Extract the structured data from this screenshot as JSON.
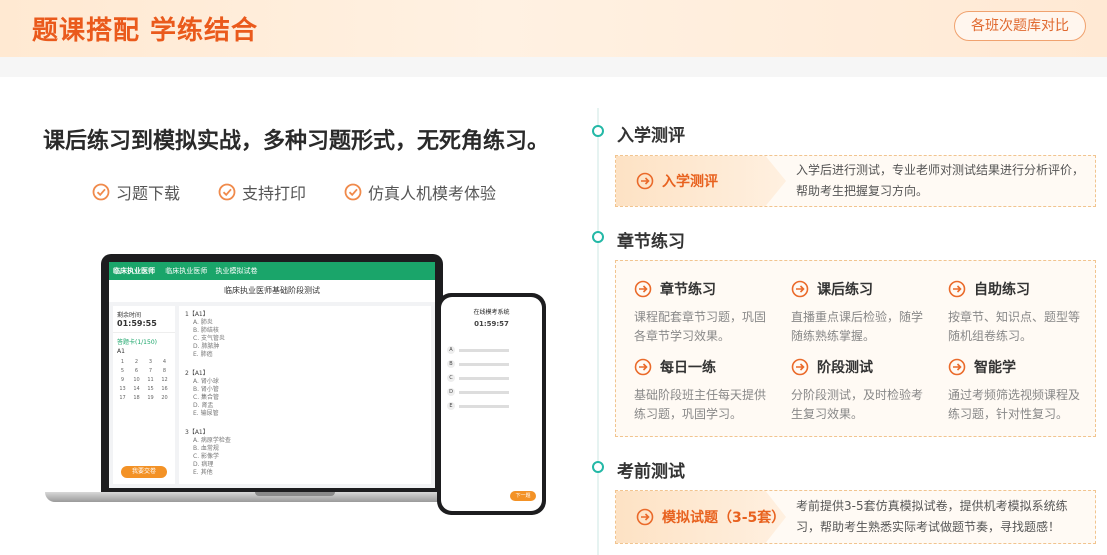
{
  "header": {
    "title": "题课搭配 学练结合",
    "compare_button": "各班次题库对比"
  },
  "left": {
    "headline": "课后练习到模拟实战，多种习题形式，无死角练习。",
    "features": [
      "习题下载",
      "支持打印",
      "仿真人机模考体验"
    ]
  },
  "laptop": {
    "brand": "临床执业医师",
    "nav": [
      "临床执业医师",
      "执业模拟试卷"
    ],
    "exam_title": "临床执业医师基础阶段测试",
    "timer_label": "剩余时间",
    "timer": "01:59:55",
    "answer_card_label": "答题卡(1/150)",
    "section_label": "A1",
    "numbers": [
      "1",
      "2",
      "3",
      "4",
      "5",
      "6",
      "7",
      "8",
      "9",
      "10",
      "11",
      "12",
      "13",
      "14",
      "15",
      "16",
      "17",
      "18",
      "19",
      "20"
    ],
    "submit": "我要交卷",
    "questions": [
      {
        "no": "1【A1】",
        "options": [
          "A. 肺炎",
          "B. 肺结核",
          "C. 支气管炎",
          "D. 肺脓肿",
          "E. 肺癌"
        ]
      },
      {
        "no": "2【A1】",
        "options": [
          "A. 肾小球",
          "B. 肾小管",
          "C. 集合管",
          "D. 肾盂",
          "E. 输尿管"
        ]
      },
      {
        "no": "3【A1】",
        "options": [
          "A. 病原学检查",
          "B. 血常规",
          "C. 影像学",
          "D. 病理",
          "E. 其他"
        ]
      }
    ]
  },
  "phone": {
    "title": "在线模考系统",
    "timer": "01:59:57",
    "options": [
      "A",
      "B",
      "C",
      "D",
      "E"
    ],
    "next": "下一题"
  },
  "timeline": {
    "entrance": {
      "title": "入学测评",
      "tag": "入学测评",
      "desc": "入学后进行测试，专业老师对测试结果进行分析评价，帮助考生把握复习方向。"
    },
    "chapter": {
      "title": "章节练习",
      "items": [
        {
          "title": "章节练习",
          "desc": "课程配套章节习题，巩固各章节学习效果。"
        },
        {
          "title": "课后练习",
          "desc": "直播重点课后检验，随学随练熟练掌握。"
        },
        {
          "title": "自助练习",
          "desc": "按章节、知识点、题型等随机组卷练习。"
        },
        {
          "title": "每日一练",
          "desc": "基础阶段班主任每天提供练习题，巩固学习。"
        },
        {
          "title": "阶段测试",
          "desc": "分阶段测试，及时检验考生复习效果。"
        },
        {
          "title": "智能学",
          "desc": "通过考频筛选视频课程及练习题，针对性复习。"
        }
      ]
    },
    "exam": {
      "title": "考前测试",
      "tag": "模拟试题（3-5套）",
      "desc": "考前提供3-5套仿真模拟试卷，提供机考模拟系统练习，帮助考生熟悉实际考试做题节奏，寻找题感！"
    }
  },
  "colors": {
    "accent": "#ea5a1c",
    "teal": "#23b8a6",
    "green": "#1aa56a",
    "orange_button": "#f39226"
  }
}
